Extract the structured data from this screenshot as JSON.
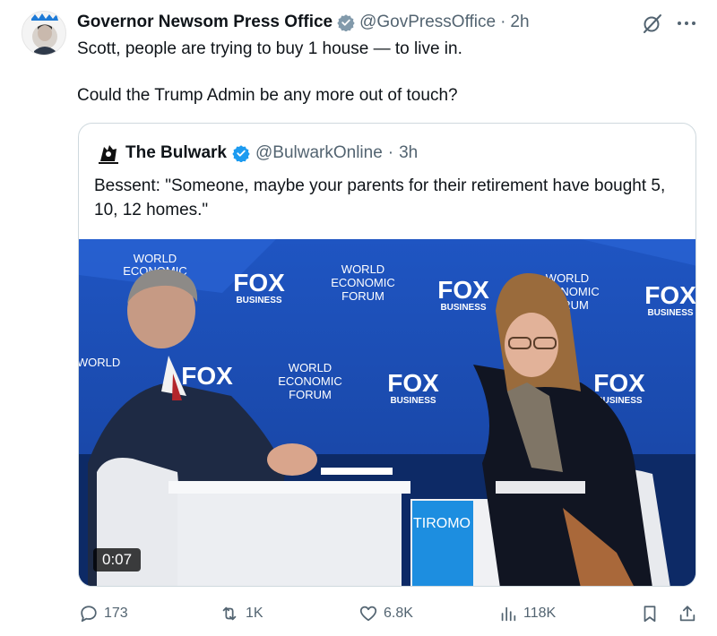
{
  "tweet": {
    "author_name": "Governor Newsom Press Office",
    "handle": "@GovPressOffice",
    "separator": "·",
    "time": "2h",
    "paragraphs": [
      "Scott, people are trying to buy 1 house — to live in.",
      "Could the Trump Admin be any more out of touch?"
    ]
  },
  "quoted": {
    "author_name": "The Bulwark",
    "handle": "@BulwarkOnline",
    "separator": "·",
    "time": "3h",
    "text": "Bessent: \"Someone, maybe your parents for their retirement have bought 5, 10, 12 homes.\"",
    "video": {
      "duration": "0:07",
      "backdrop_texts": {
        "wef_line1": "WORLD",
        "wef_line2": "ECONOMIC",
        "wef_line3": "FORUM",
        "fox_line1": "FOX",
        "fox_line2": "BUSINESS",
        "desk_text": "TIROMO"
      }
    }
  },
  "actions": {
    "replies": "173",
    "reposts": "1K",
    "likes": "6.8K",
    "views": "118K"
  },
  "colors": {
    "verified": "#1d9bf0",
    "muted": "#536471",
    "stage_blue": "#1a47a8"
  },
  "icons": [
    "verified-badge-icon",
    "grok-icon",
    "more-icon",
    "reply-icon",
    "repost-icon",
    "like-icon",
    "views-icon",
    "bookmark-icon",
    "share-icon"
  ]
}
